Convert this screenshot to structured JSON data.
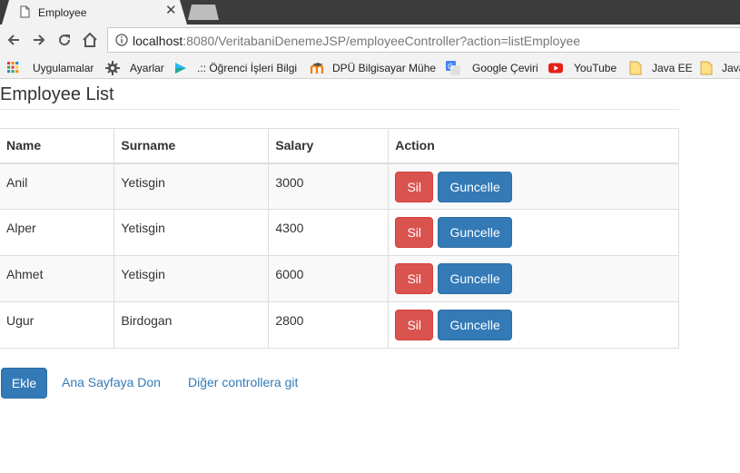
{
  "browser": {
    "tab_title": "Employee",
    "url_host": "localhost",
    "url_rest": ":8080/VeritabaniDenemeJSP/employeeController?action=listEmployee"
  },
  "bookmarks": [
    {
      "label": "Uygulamalar",
      "icon": "apps-grid-icon"
    },
    {
      "label": "Ayarlar",
      "icon": "gear-icon"
    },
    {
      "label": ".:: Öğrenci İşleri Bilgi",
      "icon": "play-icon"
    },
    {
      "label": "DPÜ Bilgisayar Mühe",
      "icon": "moodle-icon"
    },
    {
      "label": "Google Çeviri",
      "icon": "translate-icon"
    },
    {
      "label": "YouTube",
      "icon": "youtube-icon"
    },
    {
      "label": "Java EE",
      "icon": "folder-icon"
    },
    {
      "label": "Java",
      "icon": "folder-icon"
    }
  ],
  "page": {
    "title": "Employee List",
    "columns": [
      "Name",
      "Surname",
      "Salary",
      "Action"
    ],
    "rows": [
      {
        "name": "Anil",
        "surname": "Yetisgin",
        "salary": "3000"
      },
      {
        "name": "Alper",
        "surname": "Yetisgin",
        "salary": "4300"
      },
      {
        "name": "Ahmet",
        "surname": "Yetisgin",
        "salary": "6000"
      },
      {
        "name": "Ugur",
        "surname": "Birdogan",
        "salary": "2800"
      }
    ],
    "delete_label": "Sil",
    "update_label": "Guncelle",
    "add_label": "Ekle",
    "home_link": "Ana Sayfaya Don",
    "other_link": "Diğer controllera git"
  },
  "colors": {
    "danger": "#d9534f",
    "primary": "#337ab7",
    "link": "#337ab7"
  }
}
